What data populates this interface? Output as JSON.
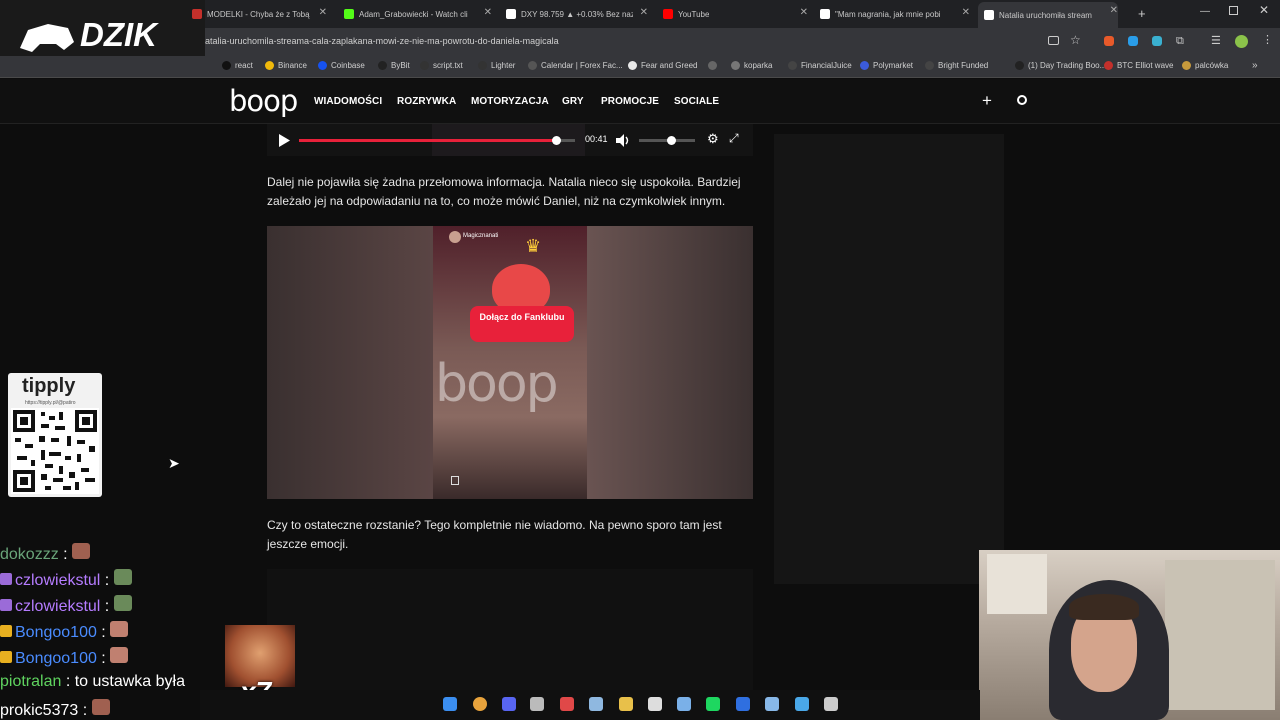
{
  "tabs": [
    {
      "label": "MODELKI - Chyba że z Tobą (pr",
      "icon": "youtube-icon",
      "color": "#c4302b"
    },
    {
      "label": "Adam_Grabowiecki - Watch cli",
      "icon": "kick-icon",
      "color": "#53fc18"
    },
    {
      "label": "DXY 98.759 ▲ +0.03% Bez naz",
      "icon": "tradingview-icon",
      "color": "#ffffff"
    },
    {
      "label": "YouTube",
      "icon": "youtube-icon",
      "color": "#ff0000"
    },
    {
      "label": "\"Mam nagrania, jak mnie pobi",
      "icon": "boop-icon",
      "color": "#ffffff"
    },
    {
      "label": "Natalia uruchomiła stream",
      "icon": "boop-icon",
      "color": "#ffffff"
    }
  ],
  "url": "atalia-uruchomila-streama-cala-zaplakana-mowi-ze-nie-ma-powrotu-do-daniela-magicala",
  "bookmarks": [
    "react",
    "Binance",
    "Coinbase",
    "ByBit",
    "script.txt",
    "Lighter",
    "Calendar | Forex Fac...",
    "Fear and Greed",
    "",
    "koparka",
    "FinancialJuice",
    "Polymarket",
    "Bright Funded",
    "(1) Day Trading Boo...",
    "BTC Elliot wave",
    "palcówka"
  ],
  "bookmark_colors": [
    "#111",
    "#f0b90b",
    "#1652f0",
    "#222",
    "#333",
    "#333",
    "#555",
    "#e8e8e8",
    "#666",
    "#777",
    "#444",
    "#3b5bdb",
    "#444",
    "#222",
    "#c4302b",
    "#c79a3c"
  ],
  "site": {
    "logo": "boop",
    "nav": [
      "WIADOMOŚCI",
      "ROZRYWKA",
      "MOTORYZACJA",
      "GRY",
      "PROMOCJE",
      "SOCIALE"
    ],
    "accent": "#e8213a"
  },
  "player": {
    "time": "00:41",
    "progress": 0.93,
    "volume": 0.4
  },
  "article": {
    "p1": "Dalej nie pojawiła się żadna przełomowa informacja. Natalia nieco się uspokoiła. Bardziej zależało jej na odpowiadaniu na to, co może mówić Daniel, niż na czymkolwiek innym.",
    "p2": "Czy to ostateczne rozstanie? Tego kompletnie nie wiadomo. Na pewno sporo tam jest jeszcze emocji.",
    "video": {
      "user": "Magicznanati",
      "sticker": "Dołącz do Fanklubu",
      "watermark": "boop"
    }
  },
  "overlay": {
    "dzik": "DZIK",
    "tipply": "tipply",
    "tipply_url": "https://tipply.pl/@patiro",
    "x7": "x7"
  },
  "chat": [
    {
      "user": "dokozzz",
      "color": "#6aa57a",
      "text": ""
    },
    {
      "user": "czlowiekstul",
      "color": "#b57cff",
      "text": ""
    },
    {
      "user": "czlowiekstul",
      "color": "#b57cff",
      "text": ""
    },
    {
      "user": "Bongoo100",
      "color": "#4a8cff",
      "text": ""
    },
    {
      "user": "Bongoo100",
      "color": "#4a8cff",
      "text": ""
    },
    {
      "user": "piotralan",
      "color": "#5fd35f",
      "text": "to ustawka była"
    },
    {
      "user": "prokic5373",
      "color": "#ffffff",
      "text": ""
    }
  ],
  "taskbar_icons": [
    {
      "name": "windows-start-icon",
      "color": "#3b8ef0"
    },
    {
      "name": "chrome-icon",
      "color": "#e8a33c"
    },
    {
      "name": "discord-icon",
      "color": "#5865f2"
    },
    {
      "name": "app-icon",
      "color": "#bbbbbb"
    },
    {
      "name": "obs-icon",
      "color": "#e04848"
    },
    {
      "name": "steam-icon",
      "color": "#8fb8e0"
    },
    {
      "name": "folder-icon",
      "color": "#e8c04a"
    },
    {
      "name": "ccleaner-icon",
      "color": "#dddddd"
    },
    {
      "name": "tool-icon",
      "color": "#7ab0e8"
    },
    {
      "name": "spotify-icon",
      "color": "#1ed760"
    },
    {
      "name": "app2-icon",
      "color": "#2f6fe0"
    },
    {
      "name": "notepad-icon",
      "color": "#88b8e8"
    },
    {
      "name": "photos-icon",
      "color": "#4aa8e8"
    },
    {
      "name": "terminal-icon",
      "color": "#cccccc"
    }
  ]
}
